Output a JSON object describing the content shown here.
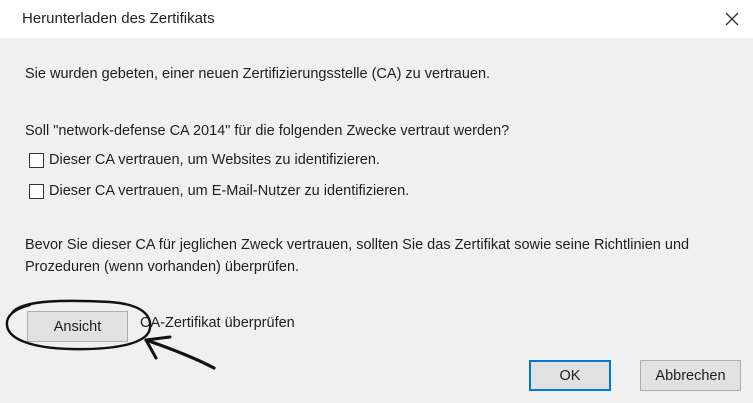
{
  "window": {
    "title": "Herunterladen des Zertifikats",
    "close_glyph": "✕"
  },
  "content": {
    "intro": "Sie wurden gebeten, einer neuen Zertifizierungsstelle (CA) zu vertrauen.",
    "question": "Soll \"network-defense CA 2014\" für die folgenden Zwecke vertraut werden?",
    "checkboxes": [
      {
        "label": "Dieser CA vertrauen, um Websites zu identifizieren.",
        "checked": false
      },
      {
        "label": "Dieser CA vertrauen, um E-Mail-Nutzer zu identifizieren.",
        "checked": false
      }
    ],
    "advice": "Bevor Sie dieser CA für jeglichen Zweck vertrauen, sollten Sie das Zertifikat sowie seine Richtlinien und Prozeduren (wenn vorhanden) überprüfen.",
    "view_button": "Ansicht",
    "view_description": "CA-Zertifikat überprüfen"
  },
  "footer": {
    "ok_label": "OK",
    "cancel_label": "Abbrechen"
  },
  "colors": {
    "accent": "#0078d7",
    "dialog_bg": "#f0f0f0",
    "annotation_ink": "#111111"
  },
  "annotation": {
    "description_icon": "hand-drawn-circle-and-arrow-annotation"
  }
}
